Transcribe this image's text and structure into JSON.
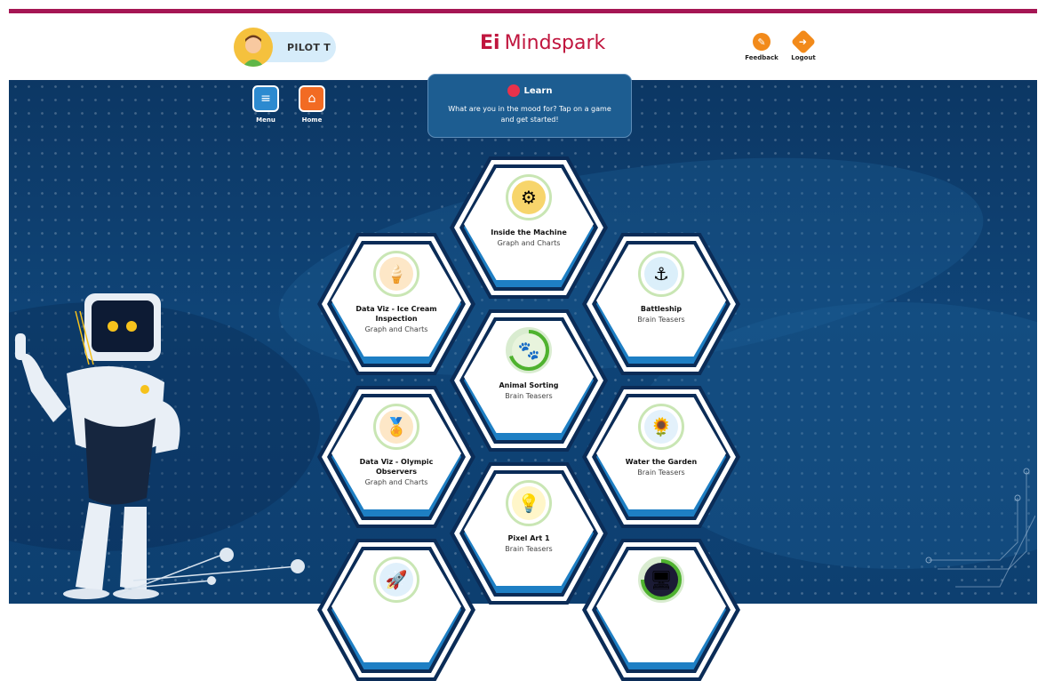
{
  "header": {
    "user_name": "PILOT T",
    "brand_name": "Mindspark",
    "brand_mark": "Ei",
    "feedback_label": "Feedback",
    "logout_label": "Logout"
  },
  "nav": {
    "menu_label": "Menu",
    "home_label": "Home"
  },
  "learn": {
    "title": "Learn",
    "description": "What are you in the mood for? Tap on a game and get started!"
  },
  "games": [
    {
      "title": "Inside the Machine",
      "category": "Graph and Charts",
      "icon": "machine-icon"
    },
    {
      "title": "Data Viz - Ice Cream Inspection",
      "category": "Graph and Charts",
      "icon": "ice-cream-icon"
    },
    {
      "title": "Battleship",
      "category": "Brain Teasers",
      "icon": "battleship-icon"
    },
    {
      "title": "Animal Sorting",
      "category": "Brain Teasers",
      "icon": "animal-icon",
      "progress": 0.7
    },
    {
      "title": "Data Viz - Olympic Observers",
      "category": "Graph and Charts",
      "icon": "olympic-icon"
    },
    {
      "title": "Water the Garden",
      "category": "Brain Teasers",
      "icon": "garden-icon"
    },
    {
      "title": "Pixel Art 1",
      "category": "Brain Teasers",
      "icon": "pixel-art-icon"
    },
    {
      "title": "",
      "category": "",
      "icon": "rocket-icon"
    },
    {
      "title": "",
      "category": "",
      "icon": "screen-icon",
      "progress": 0.75
    }
  ],
  "colors": {
    "accent": "#a51654",
    "brand": "#c0153e",
    "background": "#0f4477",
    "hex_blue": "#1e7fc4"
  }
}
